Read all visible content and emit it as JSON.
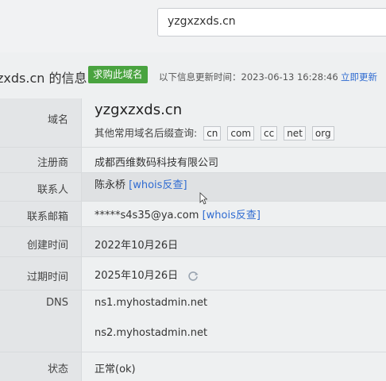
{
  "search": {
    "value": "yzgxzxds.cn"
  },
  "header": {
    "title": "zxds.cn 的信息",
    "buy_button": "求购此域名",
    "update_label": "以下信息更新时间：2023-06-13 16:28:46",
    "refresh_link": "立即更新"
  },
  "rows": {
    "domain": {
      "label": "域名",
      "value": "yzgxzxds.cn",
      "suffix_label": "其他常用域名后缀查询:",
      "suffixes": [
        "cn",
        "com",
        "cc",
        "net",
        "org"
      ]
    },
    "registrar": {
      "label": "注册商",
      "value": "成都西维数码科技有限公司"
    },
    "contact": {
      "label": "联系人",
      "value": "陈永桥",
      "link": "[whois反查]"
    },
    "email": {
      "label": "联系邮箱",
      "value": "*****s4s35@ya.com",
      "link": "[whois反查]"
    },
    "created": {
      "label": "创建时间",
      "value": "2022年10月26日"
    },
    "expires": {
      "label": "过期时间",
      "value": "2025年10月26日"
    },
    "dns": {
      "label": "DNS",
      "values": [
        "ns1.myhostadmin.net",
        "ns2.myhostadmin.net"
      ]
    },
    "status": {
      "label": "状态",
      "value": "正常(ok)"
    }
  },
  "icons": {
    "refresh": "refresh-spinner-icon",
    "cursor": "mouse-cursor-icon"
  },
  "colors": {
    "buy_button": "#49a33f",
    "link": "#2f6bd1"
  }
}
